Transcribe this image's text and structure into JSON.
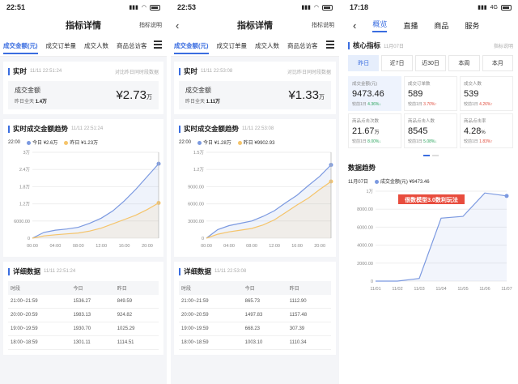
{
  "phone1": {
    "status_time": "22:51",
    "nav_title": "指标详情",
    "nav_help": "指标说明",
    "tabs": [
      "成交金额(元)",
      "成交订单量",
      "成交人数",
      "商品总访客"
    ],
    "realtime": {
      "title": "实时",
      "time": "11/11 22:51:24",
      "compare": "对比昨日同时段数据",
      "label": "成交金额",
      "sub_label": "昨日全天",
      "sub_value": "1.4万",
      "value": "¥2.73",
      "unit": "万"
    },
    "trend": {
      "title": "实时成交金额趋势",
      "time": "11/11 22:51:24",
      "legend_time": "22:00",
      "today_label": "今日",
      "today_value": "¥2.6万",
      "yesterday_label": "昨日",
      "yesterday_value": "¥1.23万",
      "y_ticks": [
        "3万",
        "2.4万",
        "1.8万",
        "1.2万",
        "6000.00",
        "0"
      ],
      "x_ticks": [
        "00:00",
        "04:00",
        "08:00",
        "12:00",
        "16:00",
        "20:00"
      ]
    },
    "detail": {
      "title": "详细数据",
      "time": "11/11 22:51:24",
      "headers": [
        "时段",
        "今日",
        "昨日"
      ],
      "rows": [
        [
          "21:00~21:59",
          "1536.27",
          "849.59"
        ],
        [
          "20:00~20:59",
          "1983.13",
          "924.82"
        ],
        [
          "19:00~19:59",
          "1930.70",
          "1025.29"
        ],
        [
          "18:00~18:59",
          "1301.11",
          "1114.51"
        ]
      ]
    }
  },
  "phone2": {
    "status_time": "22:53",
    "nav_title": "指标详情",
    "nav_help": "指标说明",
    "tabs": [
      "成交金额(元)",
      "成交订单量",
      "成交人数",
      "商品总访客"
    ],
    "realtime": {
      "title": "实时",
      "time": "11/11 22:53:08",
      "compare": "对比昨日同时段数据",
      "label": "成交金额",
      "sub_label": "昨日全天",
      "sub_value": "1.11万",
      "value": "¥1.33",
      "unit": "万"
    },
    "trend": {
      "title": "实时成交金额趋势",
      "time": "11/11 22:53:08",
      "legend_time": "22:00",
      "today_label": "今日",
      "today_value": "¥1.28万",
      "yesterday_label": "昨日",
      "yesterday_value": "¥9902.93",
      "y_ticks": [
        "1.5万",
        "1.2万",
        "9000.00",
        "6000.00",
        "3000.00",
        "0"
      ],
      "x_ticks": [
        "00:00",
        "04:00",
        "08:00",
        "12:00",
        "16:00",
        "20:00"
      ]
    },
    "detail": {
      "title": "详细数据",
      "time": "11/11 22:53:08",
      "headers": [
        "时段",
        "今日",
        "昨日"
      ],
      "rows": [
        [
          "21:00~21:59",
          "865.73",
          "1112.90"
        ],
        [
          "20:00~20:59",
          "1497.83",
          "1157.48"
        ],
        [
          "19:00~19:59",
          "668.23",
          "307.39"
        ],
        [
          "18:00~18:59",
          "1003.10",
          "1110.34"
        ]
      ]
    }
  },
  "phone3": {
    "status_time": "17:18",
    "network": "4G",
    "tabs": [
      "概览",
      "直播",
      "商品",
      "服务"
    ],
    "core": {
      "title": "核心指标",
      "date": "11月07日",
      "help": "指标说明"
    },
    "periods": [
      "昨日",
      "近7日",
      "近30日",
      "本周",
      "本月"
    ],
    "metrics": [
      {
        "label": "成交金额(元)",
        "value": "9473.46",
        "unit": "",
        "cmp_label": "较前1日",
        "change": "4.36%",
        "dir": "down"
      },
      {
        "label": "成交订单数",
        "value": "589",
        "unit": "",
        "cmp_label": "较前1日",
        "change": "3.70%",
        "dir": "up"
      },
      {
        "label": "成交人数",
        "value": "539",
        "unit": "",
        "cmp_label": "较前1日",
        "change": "4.26%",
        "dir": "up"
      },
      {
        "label": "商品点击次数",
        "value": "21.67",
        "unit": "万",
        "cmp_label": "较前1日",
        "change": "8.00%",
        "dir": "down"
      },
      {
        "label": "商品点击人数",
        "value": "8545",
        "unit": "",
        "cmp_label": "较前1日",
        "change": "5.08%",
        "dir": "down"
      },
      {
        "label": "商品点击率",
        "value": "4.28",
        "unit": "%",
        "cmp_label": "较前1日",
        "change": "1.83%",
        "dir": "up"
      }
    ],
    "trend": {
      "title": "数据趋势",
      "date": "11月07日",
      "series_label": "成交金额(元)",
      "series_value": "¥9473.46",
      "y_ticks": [
        "1万",
        "8000.00",
        "6000.00",
        "4000.00",
        "2000.00",
        "0"
      ],
      "x_ticks": [
        "11/01",
        "11/02",
        "11/03",
        "11/04",
        "11/05",
        "11/06",
        "11/07"
      ],
      "watermark": "很数模型3.0数利玩法"
    }
  },
  "colors": {
    "today": "#7b99e0",
    "yesterday": "#f5c46a",
    "accent": "#3a6de0",
    "up": "#e04a3a",
    "down": "#27a35b"
  },
  "chart_data": [
    {
      "type": "line",
      "title": "实时成交金额趋势",
      "x": [
        "00:00",
        "02:00",
        "04:00",
        "06:00",
        "08:00",
        "10:00",
        "12:00",
        "14:00",
        "16:00",
        "18:00",
        "20:00",
        "22:00"
      ],
      "ylim": [
        0,
        30000
      ],
      "series": [
        {
          "name": "今日",
          "values": [
            0,
            2000,
            2800,
            3200,
            3800,
            5200,
            7000,
            9500,
            13000,
            17000,
            21500,
            26000
          ]
        },
        {
          "name": "昨日",
          "values": [
            0,
            800,
            1200,
            1500,
            1800,
            2500,
            3500,
            5000,
            6500,
            8000,
            10000,
            12300
          ]
        }
      ]
    },
    {
      "type": "line",
      "title": "实时成交金额趋势",
      "x": [
        "00:00",
        "02:00",
        "04:00",
        "06:00",
        "08:00",
        "10:00",
        "12:00",
        "14:00",
        "16:00",
        "18:00",
        "20:00",
        "22:00"
      ],
      "ylim": [
        0,
        15000
      ],
      "series": [
        {
          "name": "今日",
          "values": [
            0,
            1500,
            2200,
            2600,
            3000,
            3800,
            4800,
            6200,
            7500,
            9200,
            10800,
            12800
          ]
        },
        {
          "name": "昨日",
          "values": [
            0,
            700,
            1100,
            1400,
            1700,
            2300,
            3200,
            4500,
            5800,
            7000,
            8500,
            9902.93
          ]
        }
      ]
    },
    {
      "type": "area",
      "title": "数据趋势",
      "x": [
        "11/01",
        "11/02",
        "11/03",
        "11/04",
        "11/05",
        "11/06",
        "11/07"
      ],
      "ylim": [
        0,
        10000
      ],
      "series": [
        {
          "name": "成交金额(元)",
          "values": [
            0,
            0,
            300,
            7000,
            7200,
            9800,
            9473.46
          ]
        }
      ]
    }
  ]
}
